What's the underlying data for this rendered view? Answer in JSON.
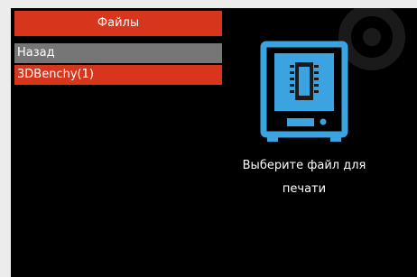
{
  "panel": {
    "title": "Файлы"
  },
  "files": {
    "items": [
      {
        "label": "Назад",
        "kind": "back"
      },
      {
        "label": "3DBenchy(1)",
        "kind": "file",
        "selected": true
      }
    ]
  },
  "preview": {
    "icon": "printer-icon",
    "hint": "Выберите файл для печати"
  },
  "colors": {
    "accent": "#d8361c",
    "back_row": "#767676",
    "icon_blue": "#3aa3e0",
    "background": "#000000"
  }
}
